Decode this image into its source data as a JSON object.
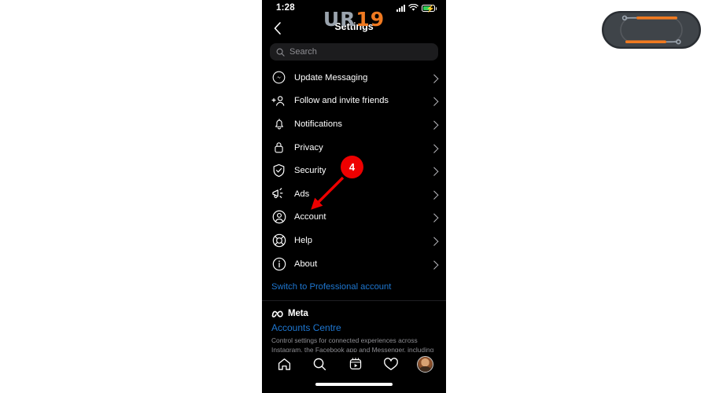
{
  "status_bar": {
    "time": "1:28",
    "icons": [
      "cellular-signal-icon",
      "wifi-icon",
      "battery-charging-icon"
    ],
    "battery_color": "#30d158"
  },
  "header": {
    "title": "Settings",
    "back_icon": "chevron-left-icon"
  },
  "search": {
    "placeholder": "Search",
    "icon": "search-icon",
    "value": ""
  },
  "menu": {
    "items": [
      {
        "label": "Update Messaging",
        "icon": "messenger-icon",
        "chevron": "chevron-right-icon"
      },
      {
        "label": "Follow and invite friends",
        "icon": "person-plus-icon",
        "chevron": "chevron-right-icon"
      },
      {
        "label": "Notifications",
        "icon": "bell-icon",
        "chevron": "chevron-right-icon"
      },
      {
        "label": "Privacy",
        "icon": "lock-icon",
        "chevron": "chevron-right-icon"
      },
      {
        "label": "Security",
        "icon": "shield-check-icon",
        "chevron": "chevron-right-icon"
      },
      {
        "label": "Ads",
        "icon": "megaphone-icon",
        "chevron": "chevron-right-icon"
      },
      {
        "label": "Account",
        "icon": "account-circle-icon",
        "chevron": "chevron-right-icon"
      },
      {
        "label": "Help",
        "icon": "lifebuoy-icon",
        "chevron": "chevron-right-icon"
      },
      {
        "label": "About",
        "icon": "info-circle-icon",
        "chevron": "chevron-right-icon"
      }
    ]
  },
  "professional": {
    "link_label": "Switch to Professional account",
    "link_color": "#1e77d1"
  },
  "meta_footer": {
    "brand_icon": "meta-infinity-icon",
    "brand_name": "Meta",
    "accounts_centre_label": "Accounts Centre",
    "description": "Control settings for connected experiences across Instagram, the Facebook app and Messenger, including story and post"
  },
  "tab_bar": {
    "items": [
      {
        "icon": "home-icon"
      },
      {
        "icon": "search-icon"
      },
      {
        "icon": "reels-icon"
      },
      {
        "icon": "heart-icon"
      },
      {
        "icon": "profile-avatar-icon"
      }
    ]
  },
  "annotation": {
    "badge_number": "4",
    "badge_color": "#ee0000",
    "arrow_color": "#ee0000",
    "points_to": "Account"
  },
  "watermark": {
    "text_gray": "UR",
    "text_orange": "19",
    "gray_color": "#9aa3ad",
    "orange_color": "#f07a21",
    "body_color": "#3f4449"
  }
}
